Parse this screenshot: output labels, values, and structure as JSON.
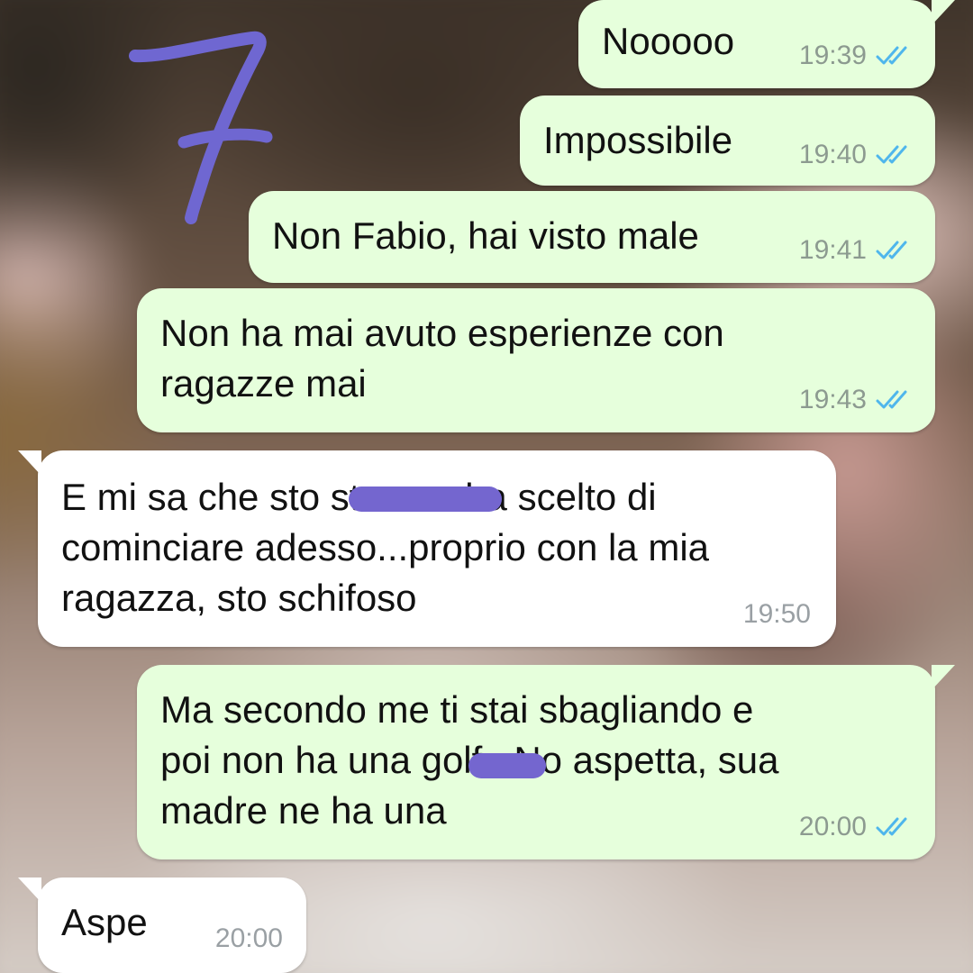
{
  "chat": {
    "accent_outgoing": "#e6ffdc",
    "accent_incoming": "#ffffff",
    "read_tick_color": "#4fb6ec",
    "annotation": {
      "label": "7",
      "color": "#6f67d1"
    },
    "messages": [
      {
        "direction": "outgoing",
        "lines": [
          "Nooooo"
        ],
        "time": "19:39",
        "status": "read"
      },
      {
        "direction": "outgoing",
        "lines": [
          "Impossibile"
        ],
        "time": "19:40",
        "status": "read"
      },
      {
        "direction": "outgoing",
        "lines": [
          "Non Fabio, hai visto male"
        ],
        "time": "19:41",
        "status": "read"
      },
      {
        "direction": "outgoing",
        "lines": [
          "Non ha mai avuto esperienze con",
          "ragazze mai"
        ],
        "time": "19:43",
        "status": "read"
      },
      {
        "direction": "incoming",
        "lines": [
          "E mi sa che sto stronzo ha scelto di",
          "cominciare adesso...proprio con la mia",
          "ragazza, sto schifoso"
        ],
        "time": "19:50",
        "status": ""
      },
      {
        "direction": "outgoing",
        "lines": [
          "Ma secondo me ti stai sbagliando e",
          "poi non ha una golf.. No aspetta, sua",
          "madre ne ha una"
        ],
        "time": "20:00",
        "status": "read"
      },
      {
        "direction": "incoming",
        "lines": [
          "Aspe"
        ],
        "time": "20:00",
        "status": ""
      }
    ]
  }
}
